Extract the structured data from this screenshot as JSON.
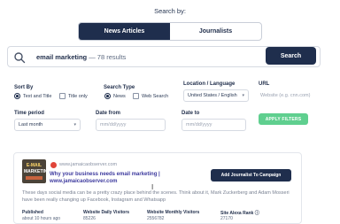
{
  "search_by": "Search by:",
  "tabs": [
    "News Articles",
    "Journalists"
  ],
  "search": {
    "query": "email marketing",
    "count_text": "— 78 results",
    "button_label": "Search"
  },
  "filters": {
    "sort_by": {
      "label": "Sort By",
      "options": [
        "Text and Title",
        "Title only"
      ],
      "selected": "Text and Title"
    },
    "search_type": {
      "label": "Search Type",
      "options": [
        "News",
        "Web Search"
      ],
      "selected": "News"
    },
    "location": {
      "label": "Location / Language",
      "value": "United States / English"
    },
    "url": {
      "label": "URL",
      "placeholder": "Website (e.g. cnn.com)"
    },
    "time_period": {
      "label": "Time period",
      "value": "Last month"
    },
    "date_from": {
      "label": "Date from",
      "placeholder": "mm/dd/yyyy"
    },
    "date_to": {
      "label": "Date to",
      "placeholder": "mm/dd/yyyy"
    },
    "apply_label": "APPLY FILTERS"
  },
  "result": {
    "thumb_text": [
      "E-MAIL",
      "MARKETING"
    ],
    "site": "www.jamaicaobserver.com",
    "headline": "Why your business needs email marketing | www.jamaicaobserver.com",
    "add_button": "Add Journalist To Campaign",
    "description": "These days social media can be a pretty crazy place behind the scenes. Think about it, Mark Zuckerberg and Adam Mosseri have been really changing up Facebook, Instagram and Whatsapp",
    "metrics": [
      {
        "label": "Published",
        "value": "about 10 hours ago"
      },
      {
        "label": "Website Daily Visitors",
        "value": "85226"
      },
      {
        "label": "Website Monthly Visitors",
        "value": "2556782"
      },
      {
        "label": "Site Alexa Rank",
        "value": "27170"
      }
    ]
  },
  "colors": {
    "primary": "#1f2e4d",
    "accent_green": "#5fcf8f",
    "link": "#3d3a9e"
  }
}
